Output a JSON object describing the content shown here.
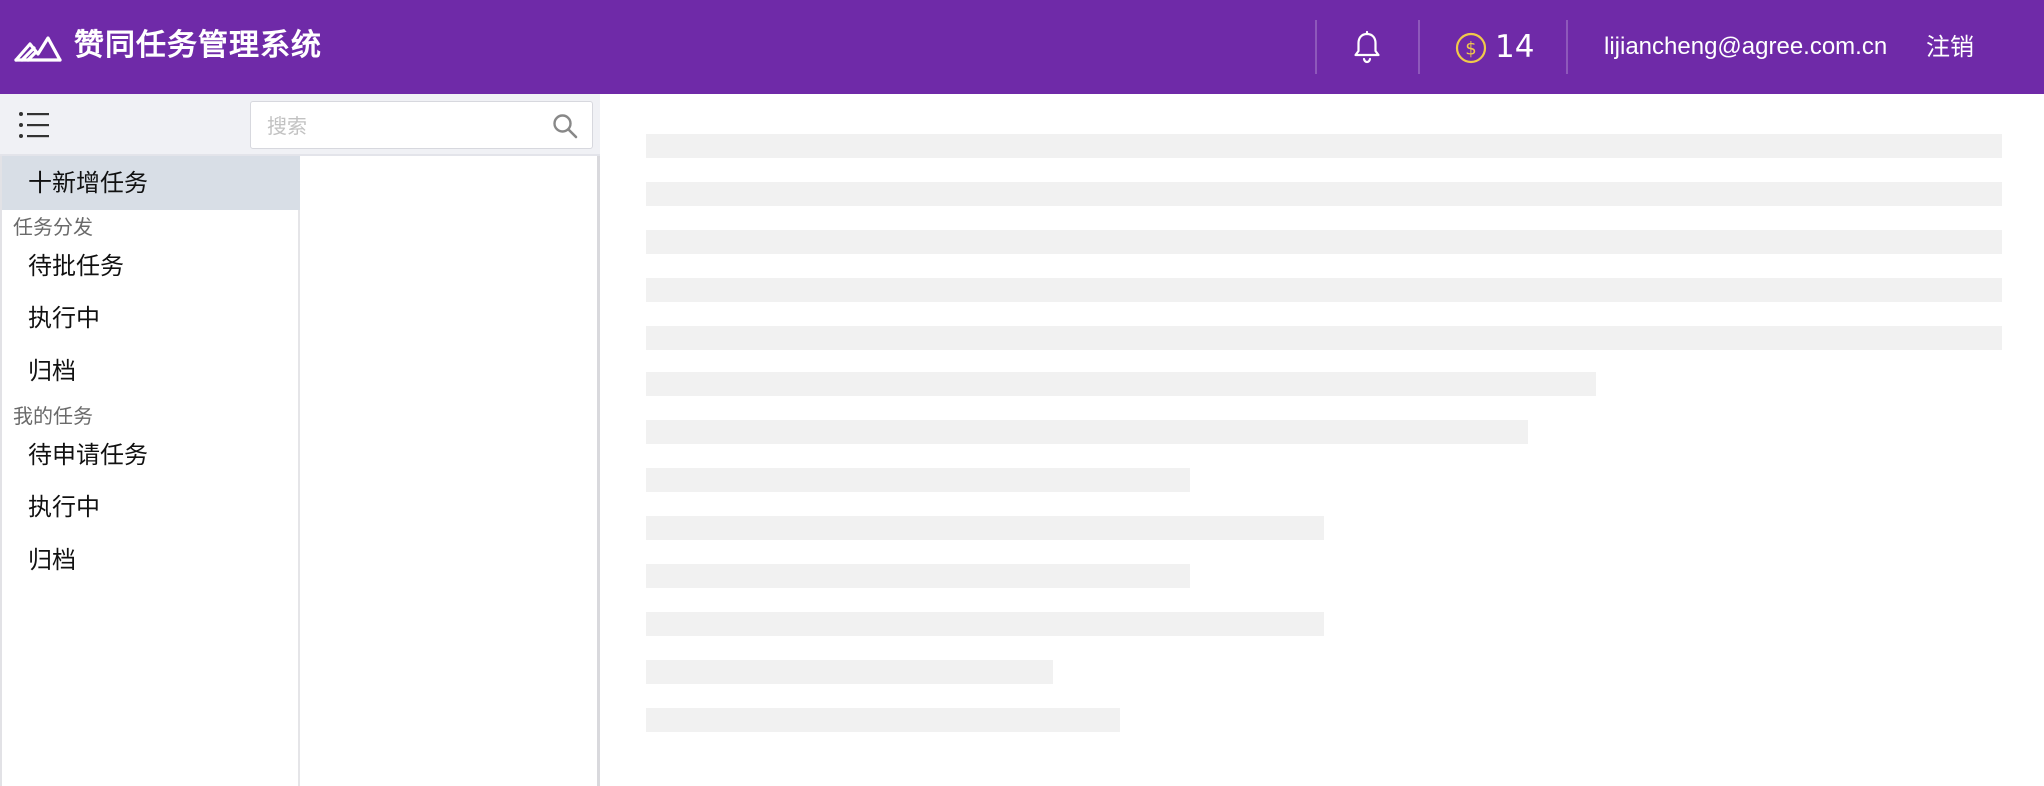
{
  "app": {
    "title": "赞同任务管理系统",
    "logo_icon": "mountain-logo-icon"
  },
  "header": {
    "notifications_icon": "bell-icon",
    "coins": {
      "icon": "dollar-coin-icon",
      "count": "14"
    },
    "user_email": "lijiancheng@agree.com.cn",
    "logout_label": "注销"
  },
  "toolbar": {
    "menu_icon": "list-menu-icon",
    "search": {
      "placeholder": "搜索",
      "value": "",
      "icon": "search-icon"
    }
  },
  "sidebar": {
    "new_task_label": "十新增任务",
    "sections": [
      {
        "title": "任务分发",
        "items": [
          {
            "label": "待批任务"
          },
          {
            "label": "执行中"
          },
          {
            "label": "归档"
          }
        ]
      },
      {
        "title": "我的任务",
        "items": [
          {
            "label": "待申请任务"
          },
          {
            "label": "执行中"
          },
          {
            "label": "归档"
          }
        ]
      }
    ]
  },
  "main": {
    "state": "loading-skeleton",
    "skeleton_line_count": 13
  },
  "colors": {
    "header_bg": "#6f2aa8",
    "coin_accent": "#f0c94a",
    "active_item_bg": "#d8dee6",
    "skeleton": "#f1f1f1"
  }
}
